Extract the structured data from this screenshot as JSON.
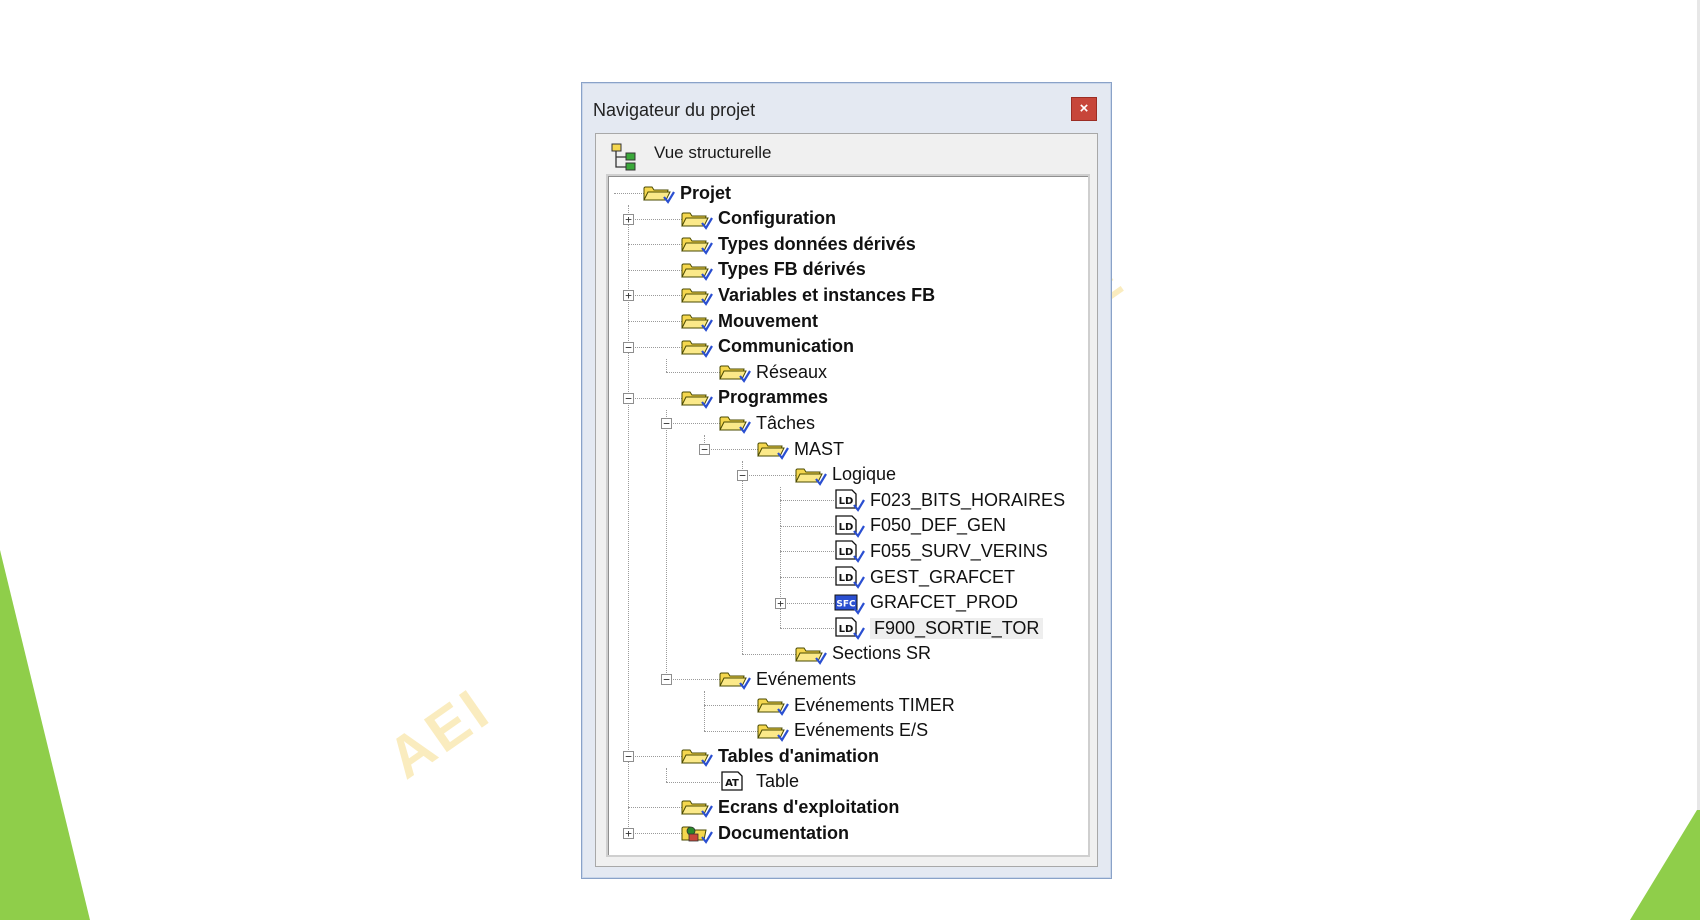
{
  "window": {
    "title": "Navigateur du projet",
    "close_label": "×",
    "view_label": "Vue structurelle"
  },
  "watermark": {
    "left": "AEI",
    "right": "E"
  },
  "colors": {
    "accent_green": "#8fce4a",
    "close_red": "#c7463a",
    "folder_yellow": "#f5d74e",
    "check_blue": "#2a4fd1"
  },
  "tree": [
    {
      "label": "Projet",
      "level": 0,
      "bold": true,
      "icon": "folder-icon",
      "name": "projet"
    },
    {
      "label": "Configuration",
      "level": 1,
      "bold": true,
      "icon": "folder-icon",
      "expander": "+",
      "name": "configuration"
    },
    {
      "label": "Types données dérivés",
      "level": 1,
      "bold": true,
      "icon": "folder-icon",
      "name": "types-donnees-derives"
    },
    {
      "label": "Types FB dérivés",
      "level": 1,
      "bold": true,
      "icon": "folder-icon",
      "name": "types-fb-derives"
    },
    {
      "label": "Variables et instances FB",
      "level": 1,
      "bold": true,
      "icon": "folder-icon",
      "expander": "+",
      "name": "variables-instances-fb"
    },
    {
      "label": "Mouvement",
      "level": 1,
      "bold": true,
      "icon": "folder-icon",
      "name": "mouvement"
    },
    {
      "label": "Communication",
      "level": 1,
      "bold": true,
      "icon": "folder-icon",
      "expander": "-",
      "name": "communication"
    },
    {
      "label": "Réseaux",
      "level": 2,
      "bold": false,
      "icon": "folder-icon",
      "name": "reseaux"
    },
    {
      "label": "Programmes",
      "level": 1,
      "bold": true,
      "icon": "folder-icon",
      "expander": "-",
      "name": "programmes"
    },
    {
      "label": "Tâches",
      "level": 2,
      "bold": false,
      "icon": "folder-icon",
      "expander": "-",
      "name": "taches"
    },
    {
      "label": "MAST",
      "level": 3,
      "bold": false,
      "icon": "folder-icon",
      "expander": "-",
      "name": "mast"
    },
    {
      "label": "Logique",
      "level": 4,
      "bold": false,
      "icon": "folder-icon",
      "expander": "-",
      "name": "logique"
    },
    {
      "label": "F023_BITS_HORAIRES",
      "level": 5,
      "bold": false,
      "icon": "ld-icon",
      "name": "f023-bits-horaires"
    },
    {
      "label": "F050_DEF_GEN",
      "level": 5,
      "bold": false,
      "icon": "ld-icon",
      "name": "f050-def-gen"
    },
    {
      "label": "F055_SURV_VERINS",
      "level": 5,
      "bold": false,
      "icon": "ld-icon",
      "name": "f055-surv-verins"
    },
    {
      "label": "GEST_GRAFCET",
      "level": 5,
      "bold": false,
      "icon": "ld-icon",
      "name": "gest-grafcet"
    },
    {
      "label": "GRAFCET_PROD",
      "level": 5,
      "bold": false,
      "icon": "sfc-icon",
      "expander": "+",
      "name": "grafcet-prod"
    },
    {
      "label": "F900_SORTIE_TOR",
      "level": 5,
      "bold": false,
      "icon": "ld-icon",
      "selected": true,
      "name": "f900-sortie-tor"
    },
    {
      "label": "Sections SR",
      "level": 4,
      "bold": false,
      "icon": "folder-icon",
      "name": "sections-sr"
    },
    {
      "label": "Evénements",
      "level": 2,
      "bold": false,
      "icon": "folder-icon",
      "expander": "-",
      "name": "evenements"
    },
    {
      "label": "Evénements TIMER",
      "level": 3,
      "bold": false,
      "icon": "folder-icon",
      "name": "evenements-timer"
    },
    {
      "label": "Evénements E/S",
      "level": 3,
      "bold": false,
      "icon": "folder-icon",
      "name": "evenements-es"
    },
    {
      "label": "Tables d'animation",
      "level": 1,
      "bold": true,
      "icon": "folder-icon",
      "expander": "-",
      "name": "tables-animation"
    },
    {
      "label": "Table",
      "level": 2,
      "bold": false,
      "icon": "at-icon",
      "name": "table"
    },
    {
      "label": "Ecrans d'exploitation",
      "level": 1,
      "bold": true,
      "icon": "folder-icon",
      "name": "ecrans-exploitation"
    },
    {
      "label": "Documentation",
      "level": 1,
      "bold": true,
      "icon": "doc-icon",
      "expander": "+",
      "name": "documentation"
    }
  ]
}
